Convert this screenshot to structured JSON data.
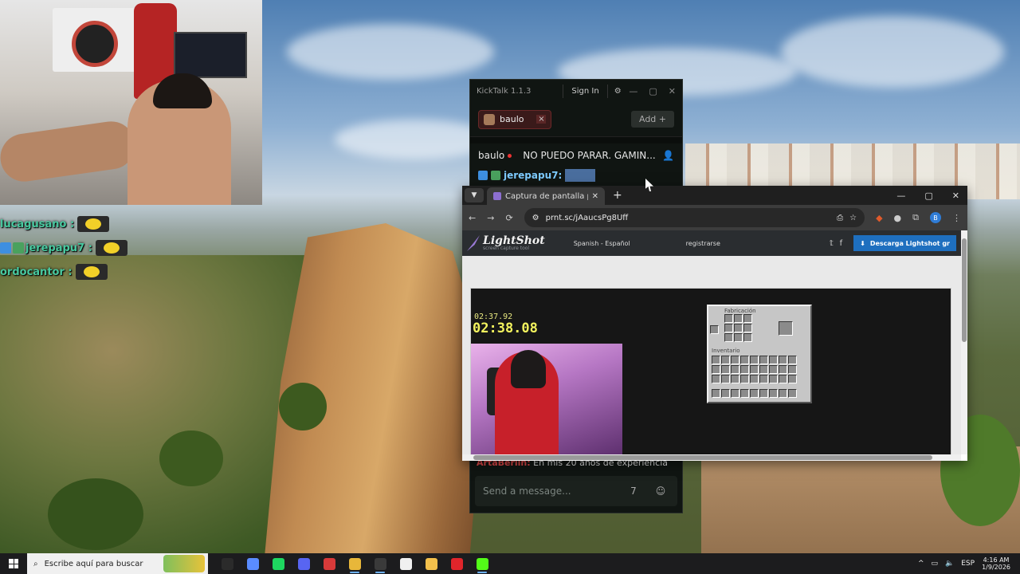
{
  "overlay_chat": [
    {
      "user": "lucagusano :",
      "badges": 0
    },
    {
      "user": "jerepapu7 :",
      "badges": 2
    },
    {
      "user": "ordocantor :",
      "badges": 0
    }
  ],
  "kicktalk": {
    "title": "KickTalk 1.1.3",
    "signin": "Sign In",
    "settings_icon": "⚙",
    "controls": [
      "—",
      "▢",
      "✕"
    ],
    "tab": {
      "name": "baulo",
      "close": "×"
    },
    "add_label": "Add",
    "add_icon": "+",
    "channel": {
      "name": "baulo",
      "stream_title": "NO PUEDO PARAR. GAMIN...",
      "user_icon": "👤"
    },
    "message": {
      "user": "jerepapu7:"
    },
    "partial_message": {
      "user": "ArtaBerlin:",
      "text": "En mis 20 años de experiencia"
    },
    "input_placeholder": "Send a message...",
    "input_icons": [
      "7tv-icon",
      "emote-icon"
    ]
  },
  "chrome": {
    "tab_title": "Captura de pantalla por Lightsh",
    "tab_close": "✕",
    "new_tab": "+",
    "window_controls": [
      "—",
      "▢",
      "✕"
    ],
    "url": "prnt.sc/jAaucsPg8Uff",
    "nav": [
      "←",
      "→",
      "⟳"
    ],
    "profile_letter": "B"
  },
  "lightshot": {
    "brand": "LightShot",
    "tagline": "screen capture tool",
    "language": "Spanish - Español",
    "register": "registrarse",
    "social": [
      "𝕥",
      "f"
    ],
    "download": "Descarga Lightshot gr",
    "timer_small": "02:37.92",
    "timer_big": "02:38.08",
    "crafting_label": "Fabricación",
    "inventory_label": "Inventario"
  },
  "taskbar": {
    "search_placeholder": "Escribe aquí para buscar",
    "apps": [
      {
        "name": "task-view-icon",
        "color": "#2b2b2b",
        "active": false
      },
      {
        "name": "copilot-icon",
        "color": "#5a8cff",
        "active": false
      },
      {
        "name": "spotify-icon",
        "color": "#1ed760",
        "active": false
      },
      {
        "name": "discord-icon",
        "color": "#5865f2",
        "active": false
      },
      {
        "name": "voice-app-icon",
        "color": "#d83a3a",
        "active": false
      },
      {
        "name": "chrome-icon",
        "color": "#e8b73a",
        "active": true
      },
      {
        "name": "obs-icon",
        "color": "#3a3a3a",
        "active": true
      },
      {
        "name": "capcut-icon",
        "color": "#f0f0f0",
        "active": false
      },
      {
        "name": "folder-icon",
        "color": "#f3c04c",
        "active": false
      },
      {
        "name": "opera-icon",
        "color": "#e0252b",
        "active": false
      },
      {
        "name": "kick-icon",
        "color": "#53fc18",
        "active": true
      }
    ],
    "tray": {
      "language": "ESP",
      "time": "4:16 AM",
      "date": "1/9/2026"
    }
  }
}
